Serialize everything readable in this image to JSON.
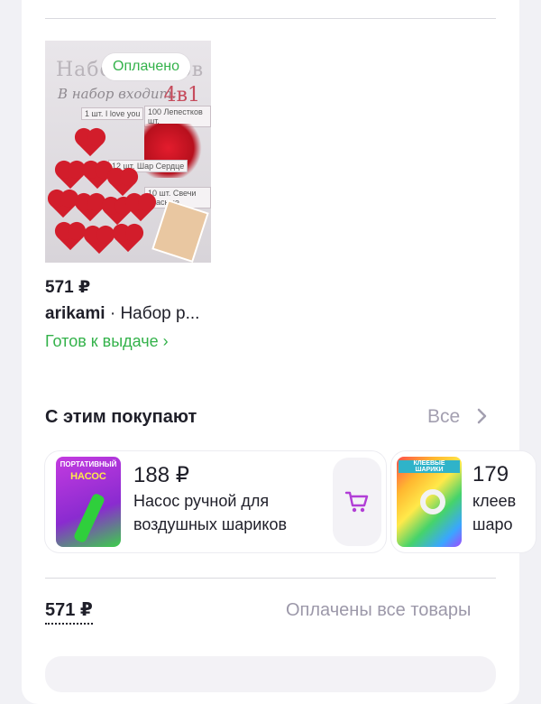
{
  "order": {
    "paid_badge": "Оплачено",
    "product_image": {
      "title": "Набор шаров",
      "subtitle": "В набор входит:",
      "variant": "4в1",
      "label_1": "1 шт. I love you",
      "label_100": "100 Лепестков шт.",
      "label_12": "12 шт. Шар Сердце",
      "label_10": "10 шт. Свечи красные"
    },
    "price": "571 ₽",
    "seller": "arikami",
    "separator": " · ",
    "product_name": "Набор р...",
    "status": "Готов к выдаче ›"
  },
  "also_bought": {
    "title": "С этим покупают",
    "all_label": "Все",
    "items": [
      {
        "price": "188 ₽",
        "name_line1": "Насос ручной для",
        "name_line2": "воздушных шариков",
        "image_label_1": "ПОРТАТИВНЫЙ",
        "image_label_2": "НАСОС"
      },
      {
        "price": "179",
        "name_line1": "клеев",
        "name_line2": "шаро",
        "image_label_1": "КЛЕЕВЫЕ ШАРИКИ"
      }
    ]
  },
  "summary": {
    "total": "571 ₽",
    "status": "Оплачены все товары"
  },
  "colors": {
    "accent_green": "#33b24a",
    "accent_purple": "#b13ed6",
    "muted": "#a39fb0"
  }
}
